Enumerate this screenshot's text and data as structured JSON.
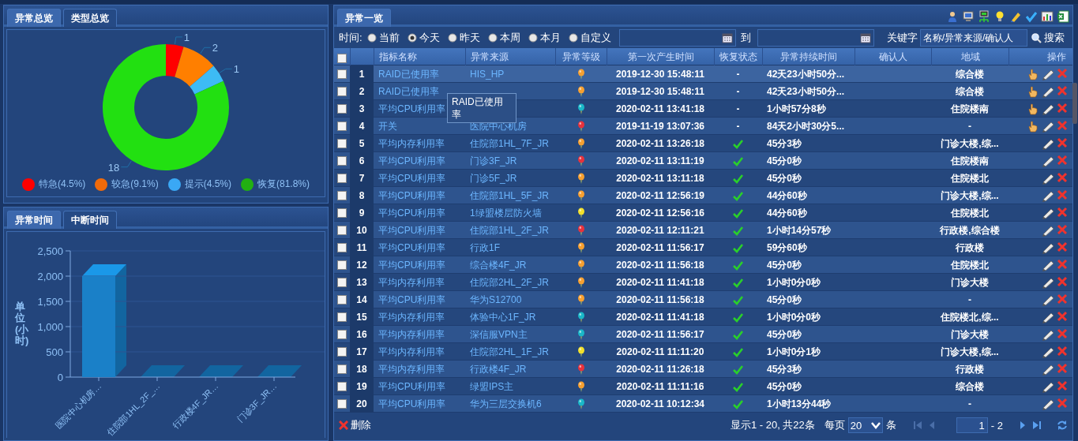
{
  "overview_panel": {
    "tabs": [
      {
        "label": "异常总览",
        "selected": true
      },
      {
        "label": "类型总览",
        "selected": false
      }
    ],
    "chart_data": {
      "type": "donut",
      "categories": [
        "特急(4.5%)",
        "较急(9.1%)",
        "提示(4.5%)",
        "恢复(81.8%)"
      ],
      "values": [
        1,
        2,
        1,
        18
      ],
      "data_labels": true
    }
  },
  "time_panel": {
    "tabs": [
      {
        "label": "异常时间",
        "selected": true
      },
      {
        "label": "中断时间",
        "selected": false
      }
    ],
    "chart_data": {
      "type": "bar",
      "categories": [
        "医院中心机房…",
        "住院部1HL_2F_…",
        "行政楼4F_JR…",
        "门诊3F_JR…"
      ],
      "series": [
        {
          "color": "#1a80c8",
          "values": [
            2000,
            0,
            0,
            0
          ]
        }
      ],
      "grid": true,
      "ylabel": "单位(小时)",
      "ylim": [
        0,
        2500
      ],
      "yticks": [
        {
          "value": 0,
          "label": "0"
        },
        {
          "value": 500,
          "label": "500"
        },
        {
          "value": 1000,
          "label": "1,000"
        },
        {
          "value": 1500,
          "label": "1,500"
        },
        {
          "value": 2000,
          "label": "2,000"
        },
        {
          "value": 2500,
          "label": "2,500"
        }
      ]
    }
  },
  "list_panel": {
    "tabs": [
      {
        "label": "异常一览",
        "selected": true
      }
    ],
    "filter": {
      "time_label": "时间:",
      "options": [
        {
          "label": "当前",
          "selected": false
        },
        {
          "label": "今天",
          "selected": true
        },
        {
          "label": "昨天",
          "selected": false
        },
        {
          "label": "本周",
          "selected": false
        },
        {
          "label": "本月",
          "selected": false
        },
        {
          "label": "自定义",
          "selected": false
        }
      ],
      "to_label": "到",
      "keyword_label": "关键字",
      "keyword_placeholder": "名称/异常来源/确认人",
      "search_button": "搜索"
    },
    "table": {
      "select_all_checked": false,
      "columns": [
        "指标名称",
        "异常来源",
        "异常等级",
        "第一次产生时间",
        "恢复状态",
        "异常持续时间",
        "确认人",
        "地域",
        "操作"
      ],
      "rows": [
        {
          "no": "1",
          "name": "RAID已使用率",
          "source": "HIS_HP",
          "color": "#f7a030",
          "time": "2019-12-30 15:48:11",
          "recovered": false,
          "recovery_text": "-",
          "duration": "42天23小时50分...",
          "region": "综合楼",
          "claimable": true,
          "checked": false,
          "selected": true
        },
        {
          "no": "2",
          "name": "RAID已使用率",
          "color": "#f7a030",
          "time": "2019-12-30 15:48:11",
          "recovered": false,
          "recovery_text": "-",
          "duration": "42天23小时50分...",
          "region": "综合楼",
          "claimable": true,
          "checked": false,
          "selected": false
        },
        {
          "no": "3",
          "name": "平均CPU利用率",
          "color": "#1ab8c8",
          "time": "2020-02-11 13:41:18",
          "recovered": false,
          "recovery_text": "-",
          "duration": "1小时57分8秒",
          "region": "住院楼南",
          "claimable": true,
          "checked": false,
          "selected": false
        },
        {
          "no": "4",
          "name": "开关",
          "source": "医院中心机房",
          "color": "#e8323c",
          "time": "2019-11-19 13:07:36",
          "recovered": false,
          "recovery_text": "-",
          "duration": "84天2小时30分5...",
          "region": "-",
          "claimable": true,
          "checked": false,
          "selected": false
        },
        {
          "no": "5",
          "name": "平均内存利用率",
          "source": "住院部1HL_7F_JR",
          "color": "#f7a030",
          "time": "2020-02-11 13:26:18",
          "recovered": true,
          "duration": "45分3秒",
          "region": "门诊大楼,综...",
          "claimable": false,
          "checked": false,
          "selected": false
        },
        {
          "no": "6",
          "name": "平均CPU利用率",
          "source": "门诊3F_JR",
          "color": "#e8323c",
          "time": "2020-02-11 13:11:19",
          "recovered": true,
          "duration": "45分0秒",
          "region": "住院楼南",
          "claimable": false,
          "checked": false,
          "selected": false
        },
        {
          "no": "7",
          "name": "平均CPU利用率",
          "source": "门诊5F_JR",
          "color": "#f7a030",
          "time": "2020-02-11 13:11:18",
          "recovered": true,
          "duration": "45分0秒",
          "region": "住院楼北",
          "claimable": false,
          "checked": false,
          "selected": false
        },
        {
          "no": "8",
          "name": "平均CPU利用率",
          "source": "住院部1HL_5F_JR",
          "color": "#f7a030",
          "time": "2020-02-11 12:56:19",
          "recovered": true,
          "duration": "44分60秒",
          "region": "门诊大楼,综...",
          "claimable": false,
          "checked": false,
          "selected": false
        },
        {
          "no": "9",
          "name": "平均CPU利用率",
          "source": "1绿盟楼层防火墙",
          "color": "#f2e02a",
          "time": "2020-02-11 12:56:16",
          "recovered": true,
          "duration": "44分60秒",
          "region": "住院楼北",
          "claimable": false,
          "checked": false,
          "selected": false
        },
        {
          "no": "10",
          "name": "平均CPU利用率",
          "source": "住院部1HL_2F_JR",
          "color": "#e8323c",
          "time": "2020-02-11 12:11:21",
          "recovered": true,
          "duration": "1小时14分57秒",
          "region": "行政楼,综合楼",
          "claimable": false,
          "checked": false,
          "selected": false
        },
        {
          "no": "11",
          "name": "平均CPU利用率",
          "source": "行政1F",
          "color": "#f7a030",
          "time": "2020-02-11 11:56:17",
          "recovered": true,
          "duration": "59分60秒",
          "region": "行政楼",
          "claimable": false,
          "checked": false,
          "selected": false
        },
        {
          "no": "12",
          "name": "平均CPU利用率",
          "source": "综合楼4F_JR",
          "color": "#f7a030",
          "time": "2020-02-11 11:56:18",
          "recovered": true,
          "duration": "45分0秒",
          "region": "住院楼北",
          "claimable": false,
          "checked": false,
          "selected": false
        },
        {
          "no": "13",
          "name": "平均内存利用率",
          "source": "住院部2HL_2F_JR",
          "color": "#f7a030",
          "time": "2020-02-11 11:41:18",
          "recovered": true,
          "duration": "1小时0分0秒",
          "region": "门诊大楼",
          "claimable": false,
          "checked": false,
          "selected": false
        },
        {
          "no": "14",
          "name": "平均CPU利用率",
          "source": "华为S12700",
          "color": "#f7a030",
          "time": "2020-02-11 11:56:18",
          "recovered": true,
          "duration": "45分0秒",
          "region": "-",
          "claimable": false,
          "checked": false,
          "selected": false
        },
        {
          "no": "15",
          "name": "平均内存利用率",
          "source": "体验中心1F_JR",
          "color": "#1ab8c8",
          "time": "2020-02-11 11:41:18",
          "recovered": true,
          "duration": "1小时0分0秒",
          "region": "住院楼北,综...",
          "claimable": false,
          "checked": false,
          "selected": false
        },
        {
          "no": "16",
          "name": "平均内存利用率",
          "source": "深信服VPN主",
          "color": "#1ab8c8",
          "time": "2020-02-11 11:56:17",
          "recovered": true,
          "duration": "45分0秒",
          "region": "门诊大楼",
          "claimable": false,
          "checked": false,
          "selected": false
        },
        {
          "no": "17",
          "name": "平均内存利用率",
          "source": "住院部2HL_1F_JR",
          "color": "#f2e02a",
          "time": "2020-02-11 11:11:20",
          "recovered": true,
          "duration": "1小时0分1秒",
          "region": "门诊大楼,综...",
          "claimable": false,
          "checked": false,
          "selected": false
        },
        {
          "no": "18",
          "name": "平均内存利用率",
          "source": "行政楼4F_JR",
          "color": "#e8323c",
          "time": "2020-02-11 11:26:18",
          "recovered": true,
          "duration": "45分3秒",
          "region": "行政楼",
          "claimable": false,
          "checked": false,
          "selected": false
        },
        {
          "no": "19",
          "name": "平均CPU利用率",
          "source": "绿盟IPS主",
          "color": "#f7a030",
          "time": "2020-02-11 11:11:16",
          "recovered": true,
          "duration": "45分0秒",
          "region": "综合楼",
          "claimable": false,
          "checked": false,
          "selected": false
        },
        {
          "no": "20",
          "name": "平均CPU利用率",
          "source": "华为三层交换机6",
          "color": "#1ab8c8",
          "time": "2020-02-11 10:12:34",
          "recovered": true,
          "duration": "1小时13分44秒",
          "region": "-",
          "claimable": false,
          "checked": false,
          "selected": false
        }
      ]
    },
    "tooltip": "RAID已使用率",
    "footer": {
      "delete_button": "删除",
      "summary": "显示1 - 20, 共22条",
      "per_page_label": "每页",
      "per_page": "20",
      "per_page_unit": "条",
      "page": "1",
      "page_total": "- 2"
    }
  }
}
